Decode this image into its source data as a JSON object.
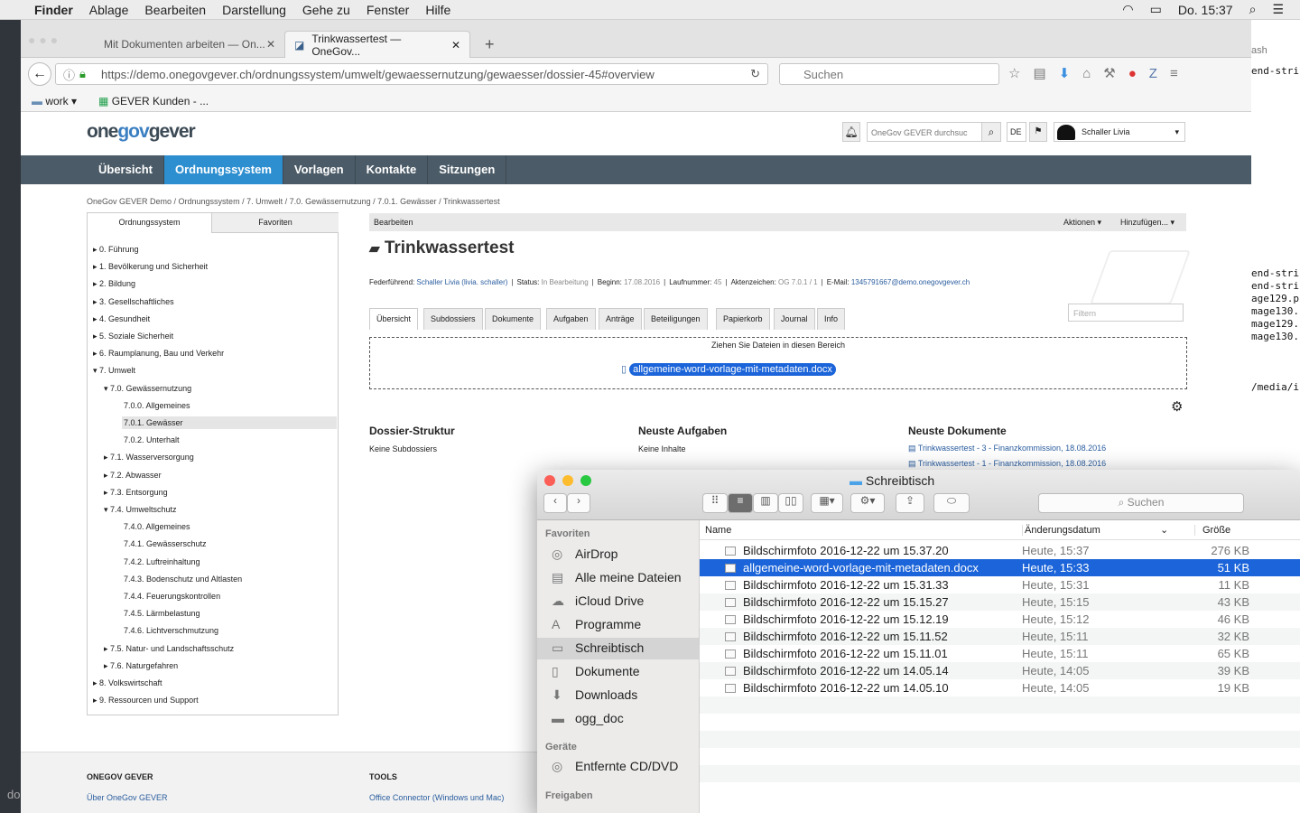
{
  "menubar": {
    "app": "Finder",
    "items": [
      "Ablage",
      "Bearbeiten",
      "Darstellung",
      "Gehe zu",
      "Fenster",
      "Hilfe"
    ],
    "clock": "Do. 15:37"
  },
  "terminal": {
    "lines": [
      "ash",
      "end-stri",
      "end-stri",
      "end-stri",
      "age129.p",
      "mage130.",
      "mage129.",
      "mage130.",
      "/media/i"
    ],
    "left_text": "do"
  },
  "browser": {
    "tabs": [
      {
        "label": "Mit Dokumenten arbeiten — On..."
      },
      {
        "label": "Trinkwassertest — OneGov..."
      }
    ],
    "url": "https://demo.onegovgever.ch/ordnungssystem/umwelt/gewaessernutzung/gewaesser/dossier-45#overview",
    "url_domain": "demo.onegovgever.ch",
    "search_placeholder": "Suchen",
    "bookmarks": [
      {
        "label": "work"
      },
      {
        "label": "GEVER Kunden - ..."
      }
    ]
  },
  "site": {
    "logo_one": "one",
    "logo_gov": "gov",
    "logo_gever": "gever",
    "search_placeholder": "OneGov GEVER durchsuc",
    "lang": "DE",
    "user": "Schaller Livia",
    "nav": [
      "Übersicht",
      "Ordnungssystem",
      "Vorlagen",
      "Kontakte",
      "Sitzungen"
    ],
    "nav_active": 1,
    "breadcrumb": "OneGov GEVER Demo / Ordnungssystem / 7. Umwelt / 7.0. Gewässernutzung / 7.0.1. Gewässer / Trinkwassertest",
    "tree_tabs": [
      "Ordnungssystem",
      "Favoriten"
    ],
    "tree": [
      "0. Führung",
      "1. Bevölkerung und Sicherheit",
      "2. Bildung",
      "3. Gesellschaftliches",
      "4. Gesundheit",
      "5. Soziale Sicherheit",
      "6. Raumplanung, Bau und Verkehr",
      "7. Umwelt",
      "7.0. Gewässernutzung",
      "7.0.0. Allgemeines",
      "7.0.1. Gewässer",
      "7.0.2. Unterhalt",
      "7.1. Wasserversorgung",
      "7.2. Abwasser",
      "7.3. Entsorgung",
      "7.4. Umweltschutz",
      "7.4.0. Allgemeines",
      "7.4.1. Gewässerschutz",
      "7.4.2. Luftreinhaltung",
      "7.4.3. Bodenschutz und Altlasten",
      "7.4.4. Feuerungskontrollen",
      "7.4.5. Lärmbelastung",
      "7.4.6. Lichtverschmutzung",
      "7.5. Natur- und Landschaftsschutz",
      "7.6. Naturgefahren",
      "8. Volkswirtschaft",
      "9. Ressourcen und Support"
    ],
    "toolbar": {
      "edit": "Bearbeiten",
      "actions": "Aktionen ▾",
      "add": "Hinzufügen... ▾"
    },
    "title": "Trinkwassertest",
    "meta": [
      {
        "k": "Federführend: ",
        "v": "Schaller Livia (livia. schaller)"
      },
      {
        "k": "Status: ",
        "v": "In Bearbeitung"
      },
      {
        "k": "Beginn: ",
        "v": "17.08.2016"
      },
      {
        "k": "Laufnummer: ",
        "v": "45"
      },
      {
        "k": "Aktenzeichen: ",
        "v": "OG 7.0.1 / 1"
      },
      {
        "k": "E-Mail: ",
        "v": "1345791667@demo.onegovgever.ch"
      }
    ],
    "filter_placeholder": "Filtern",
    "tabs": [
      "Übersicht",
      "Subdossiers",
      "Dokumente",
      "Aufgaben",
      "Anträge",
      "Beteiligungen",
      "Papierkorb",
      "Journal",
      "Info"
    ],
    "dropzone": "Ziehen Sie Dateien in diesen Bereich",
    "drag_file": "allgemeine-word-vorlage-mit-metadaten.docx",
    "sections": [
      {
        "title": "Dossier-Struktur",
        "text": "Keine Subdossiers"
      },
      {
        "title": "Neuste Aufgaben",
        "text": "Keine Inhalte"
      },
      {
        "title": "Neuste Dokumente"
      }
    ],
    "docs": [
      "Trinkwassertest - 3 - Finanzkommission, 18.08.2016",
      "Trinkwassertest - 1 - Finanzkommission, 18.08.2016"
    ],
    "footer": {
      "col1": "ONEGOV GEVER",
      "col1_link": "Über OneGov GEVER",
      "col2": "TOOLS",
      "col2_link": "Office Connector (Windows und Mac)"
    }
  },
  "finder": {
    "title": "Schreibtisch",
    "search": "Suchen",
    "sidebar": {
      "favorites_header": "Favoriten",
      "favorites": [
        "AirDrop",
        "Alle meine Dateien",
        "iCloud Drive",
        "Programme",
        "Schreibtisch",
        "Dokumente",
        "Downloads",
        "ogg_doc"
      ],
      "selected": "Schreibtisch",
      "devices_header": "Geräte",
      "devices": [
        "Entfernte CD/DVD"
      ],
      "shares_header": "Freigaben"
    },
    "columns": {
      "name": "Name",
      "date": "Änderungsdatum",
      "size": "Größe"
    },
    "files": [
      {
        "name": "Bildschirmfoto 2016-12-22 um 15.37.20",
        "date": "Heute, 15:37",
        "size": "276 KB"
      },
      {
        "name": "allgemeine-word-vorlage-mit-metadaten.docx",
        "date": "Heute, 15:33",
        "size": "51 KB",
        "selected": true
      },
      {
        "name": "Bildschirmfoto 2016-12-22 um 15.31.33",
        "date": "Heute, 15:31",
        "size": "11 KB"
      },
      {
        "name": "Bildschirmfoto 2016-12-22 um 15.15.27",
        "date": "Heute, 15:15",
        "size": "43 KB"
      },
      {
        "name": "Bildschirmfoto 2016-12-22 um 15.12.19",
        "date": "Heute, 15:12",
        "size": "46 KB"
      },
      {
        "name": "Bildschirmfoto 2016-12-22 um 15.11.52",
        "date": "Heute, 15:11",
        "size": "32 KB"
      },
      {
        "name": "Bildschirmfoto 2016-12-22 um 15.11.01",
        "date": "Heute, 15:11",
        "size": "65 KB"
      },
      {
        "name": "Bildschirmfoto 2016-12-22 um 14.05.14",
        "date": "Heute, 14:05",
        "size": "39 KB"
      },
      {
        "name": "Bildschirmfoto 2016-12-22 um 14.05.10",
        "date": "Heute, 14:05",
        "size": "19 KB"
      }
    ]
  }
}
